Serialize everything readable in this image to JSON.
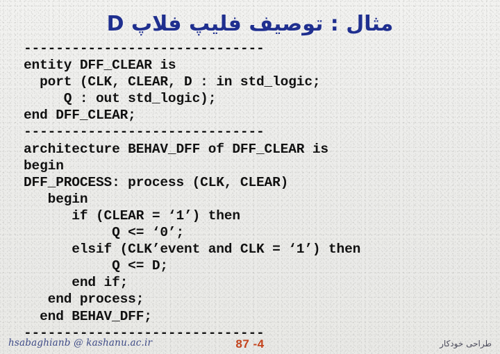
{
  "slide": {
    "title": "مثال : توصیف فلیپ فلاپ D",
    "title_color": "#1f2f8f",
    "background_color": "#eeeeec"
  },
  "code": {
    "language": "VHDL",
    "text_color": "#111111",
    "separator": "------------------------------",
    "lines": [
      {
        "kind": "separator",
        "text": "------------------------------"
      },
      {
        "kind": "code",
        "text": "entity DFF_CLEAR is"
      },
      {
        "kind": "code",
        "text": "  port (CLK, CLEAR, D : in std_logic;"
      },
      {
        "kind": "code",
        "text": "     Q : out std_logic);"
      },
      {
        "kind": "code",
        "text": "end DFF_CLEAR;"
      },
      {
        "kind": "separator",
        "text": "------------------------------"
      },
      {
        "kind": "code",
        "text": "architecture BEHAV_DFF of DFF_CLEAR is"
      },
      {
        "kind": "code",
        "text": "begin"
      },
      {
        "kind": "code",
        "text": "DFF_PROCESS: process (CLK, CLEAR)"
      },
      {
        "kind": "code",
        "text": "   begin"
      },
      {
        "kind": "code",
        "text": "      if (CLEAR = ‘1’) then"
      },
      {
        "kind": "code",
        "text": "           Q <= ‘0’;"
      },
      {
        "kind": "code",
        "text": "      elsif (CLK’event and CLK = ‘1’) then"
      },
      {
        "kind": "code",
        "text": "           Q <= D;"
      },
      {
        "kind": "code",
        "text": "      end if;"
      },
      {
        "kind": "code",
        "text": "   end process;"
      },
      {
        "kind": "code",
        "text": "  end BEHAV_DFF;"
      },
      {
        "kind": "separator",
        "text": "------------------------------"
      }
    ]
  },
  "footer": {
    "email": "hsabaghianb @ kashanu.ac.ir",
    "page_number": "87 -4",
    "page_number_color": "#c4441d",
    "right_label": "طراحی خودکار"
  }
}
